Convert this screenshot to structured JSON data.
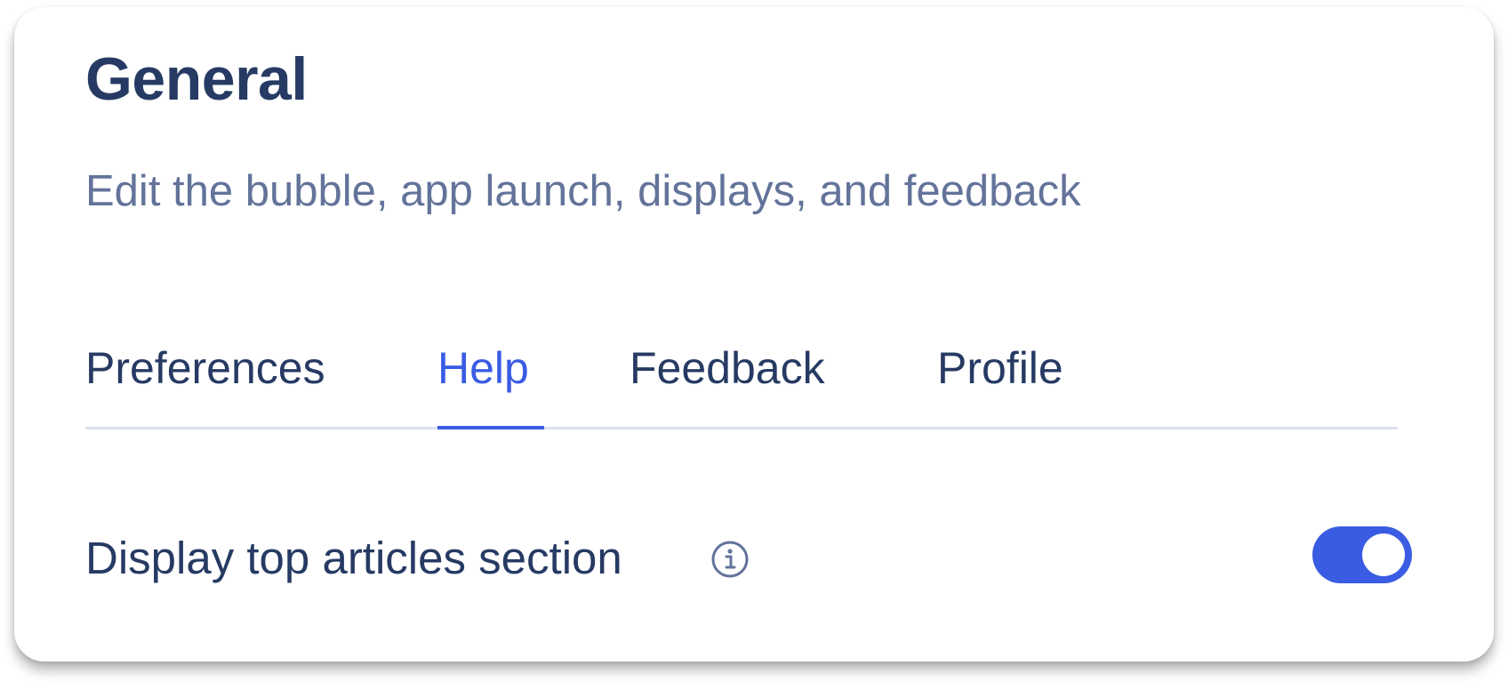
{
  "panel": {
    "title": "General",
    "subtitle": "Edit the bubble, app launch, displays, and feedback"
  },
  "tabs": [
    {
      "label": "Preferences",
      "active": false
    },
    {
      "label": "Help",
      "active": true
    },
    {
      "label": "Feedback",
      "active": false
    },
    {
      "label": "Profile",
      "active": false
    }
  ],
  "settings": {
    "top_articles": {
      "label": "Display top articles section",
      "info_icon": "info-icon",
      "enabled": true
    }
  },
  "colors": {
    "accent": "#3a5ce3",
    "heading": "#263a63",
    "subtext": "#63739a",
    "divider": "#dde1ee"
  }
}
